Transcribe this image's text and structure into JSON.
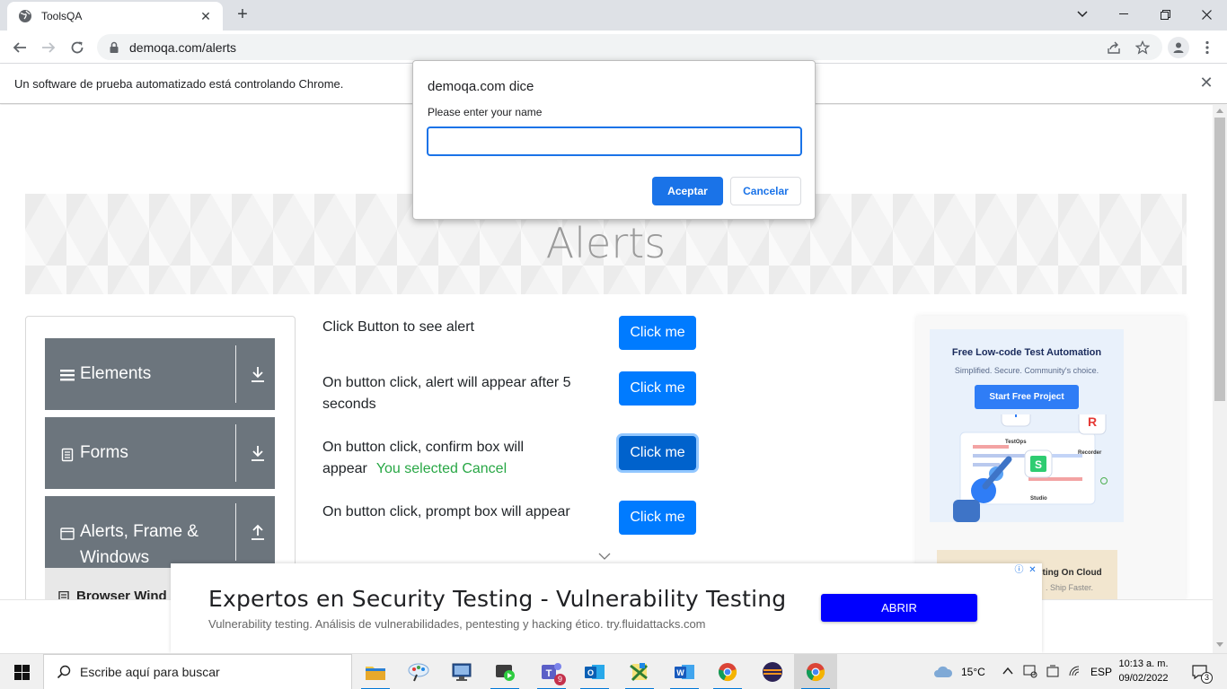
{
  "browser": {
    "tab_title": "ToolsQA",
    "tab_close": "✕",
    "new_tab": "+",
    "url": "demoqa.com/alerts",
    "window_controls": [
      "minimize",
      "restore",
      "close"
    ]
  },
  "infobar": {
    "text": "Un software de prueba automatizado está controlando Chrome.",
    "close": "✕"
  },
  "page": {
    "title": "Alerts"
  },
  "sidebar": {
    "groups": [
      {
        "label": "Elements",
        "icon": "menu-lines-icon",
        "arrow": "download-arrow-icon"
      },
      {
        "label": "Forms",
        "icon": "document-icon",
        "arrow": "download-arrow-icon"
      },
      {
        "label": "Alerts, Frame & Windows",
        "label_line1": "Alerts, Frame &",
        "label_line2": "Windows",
        "icon": "window-icon",
        "arrow": "upload-arrow-icon"
      }
    ],
    "submenu_item": "Browser Wind"
  },
  "alerts": {
    "rows": [
      {
        "text": "Click Button to see alert",
        "button": "Click me"
      },
      {
        "text": "On button click, alert will appear after 5 seconds",
        "button": "Click me"
      },
      {
        "text_line1": "On button click, confirm box will",
        "text_line2": "appear",
        "status": "You selected Cancel",
        "button": "Click me"
      },
      {
        "text": "On button click, prompt box will appear",
        "button": "Click me"
      }
    ]
  },
  "ad_right": {
    "headline": "Free Low-code Test Automation",
    "subline": "Simplified. Secure. Community's choice.",
    "cta": "Start Free Project",
    "labels": [
      "TestOps",
      "Recorder",
      "Studio"
    ],
    "small_ad_title": "sting On Cloud",
    "small_ad_sub": ". Ship Faster."
  },
  "bottom_ad": {
    "title": "Expertos en Security Testing - Vulnerability Testing",
    "description": "Vulnerability testing. Análisis de vulnerabilidades, pentesting y hacking ético. try.fluidattacks.com",
    "button": "ABRIR",
    "adchoices_info": "ⓘ",
    "adchoices_close": "✕"
  },
  "dialog": {
    "title": "demoqa.com dice",
    "message": "Please enter your name",
    "input_value": "",
    "ok_label": "Aceptar",
    "cancel_label": "Cancelar"
  },
  "taskbar": {
    "search_placeholder": "Escribe aquí para buscar",
    "teams_badge": "9",
    "weather": "15°C",
    "language": "ESP",
    "time": "10:13 a. m.",
    "date": "09/02/2022",
    "notifications": "3"
  },
  "colors": {
    "primary_button": "#007bff",
    "sidebar_header": "#6c757d",
    "success_text": "#28a745",
    "dialog_accent": "#1a73e8",
    "ad_button": "#0000ff"
  }
}
